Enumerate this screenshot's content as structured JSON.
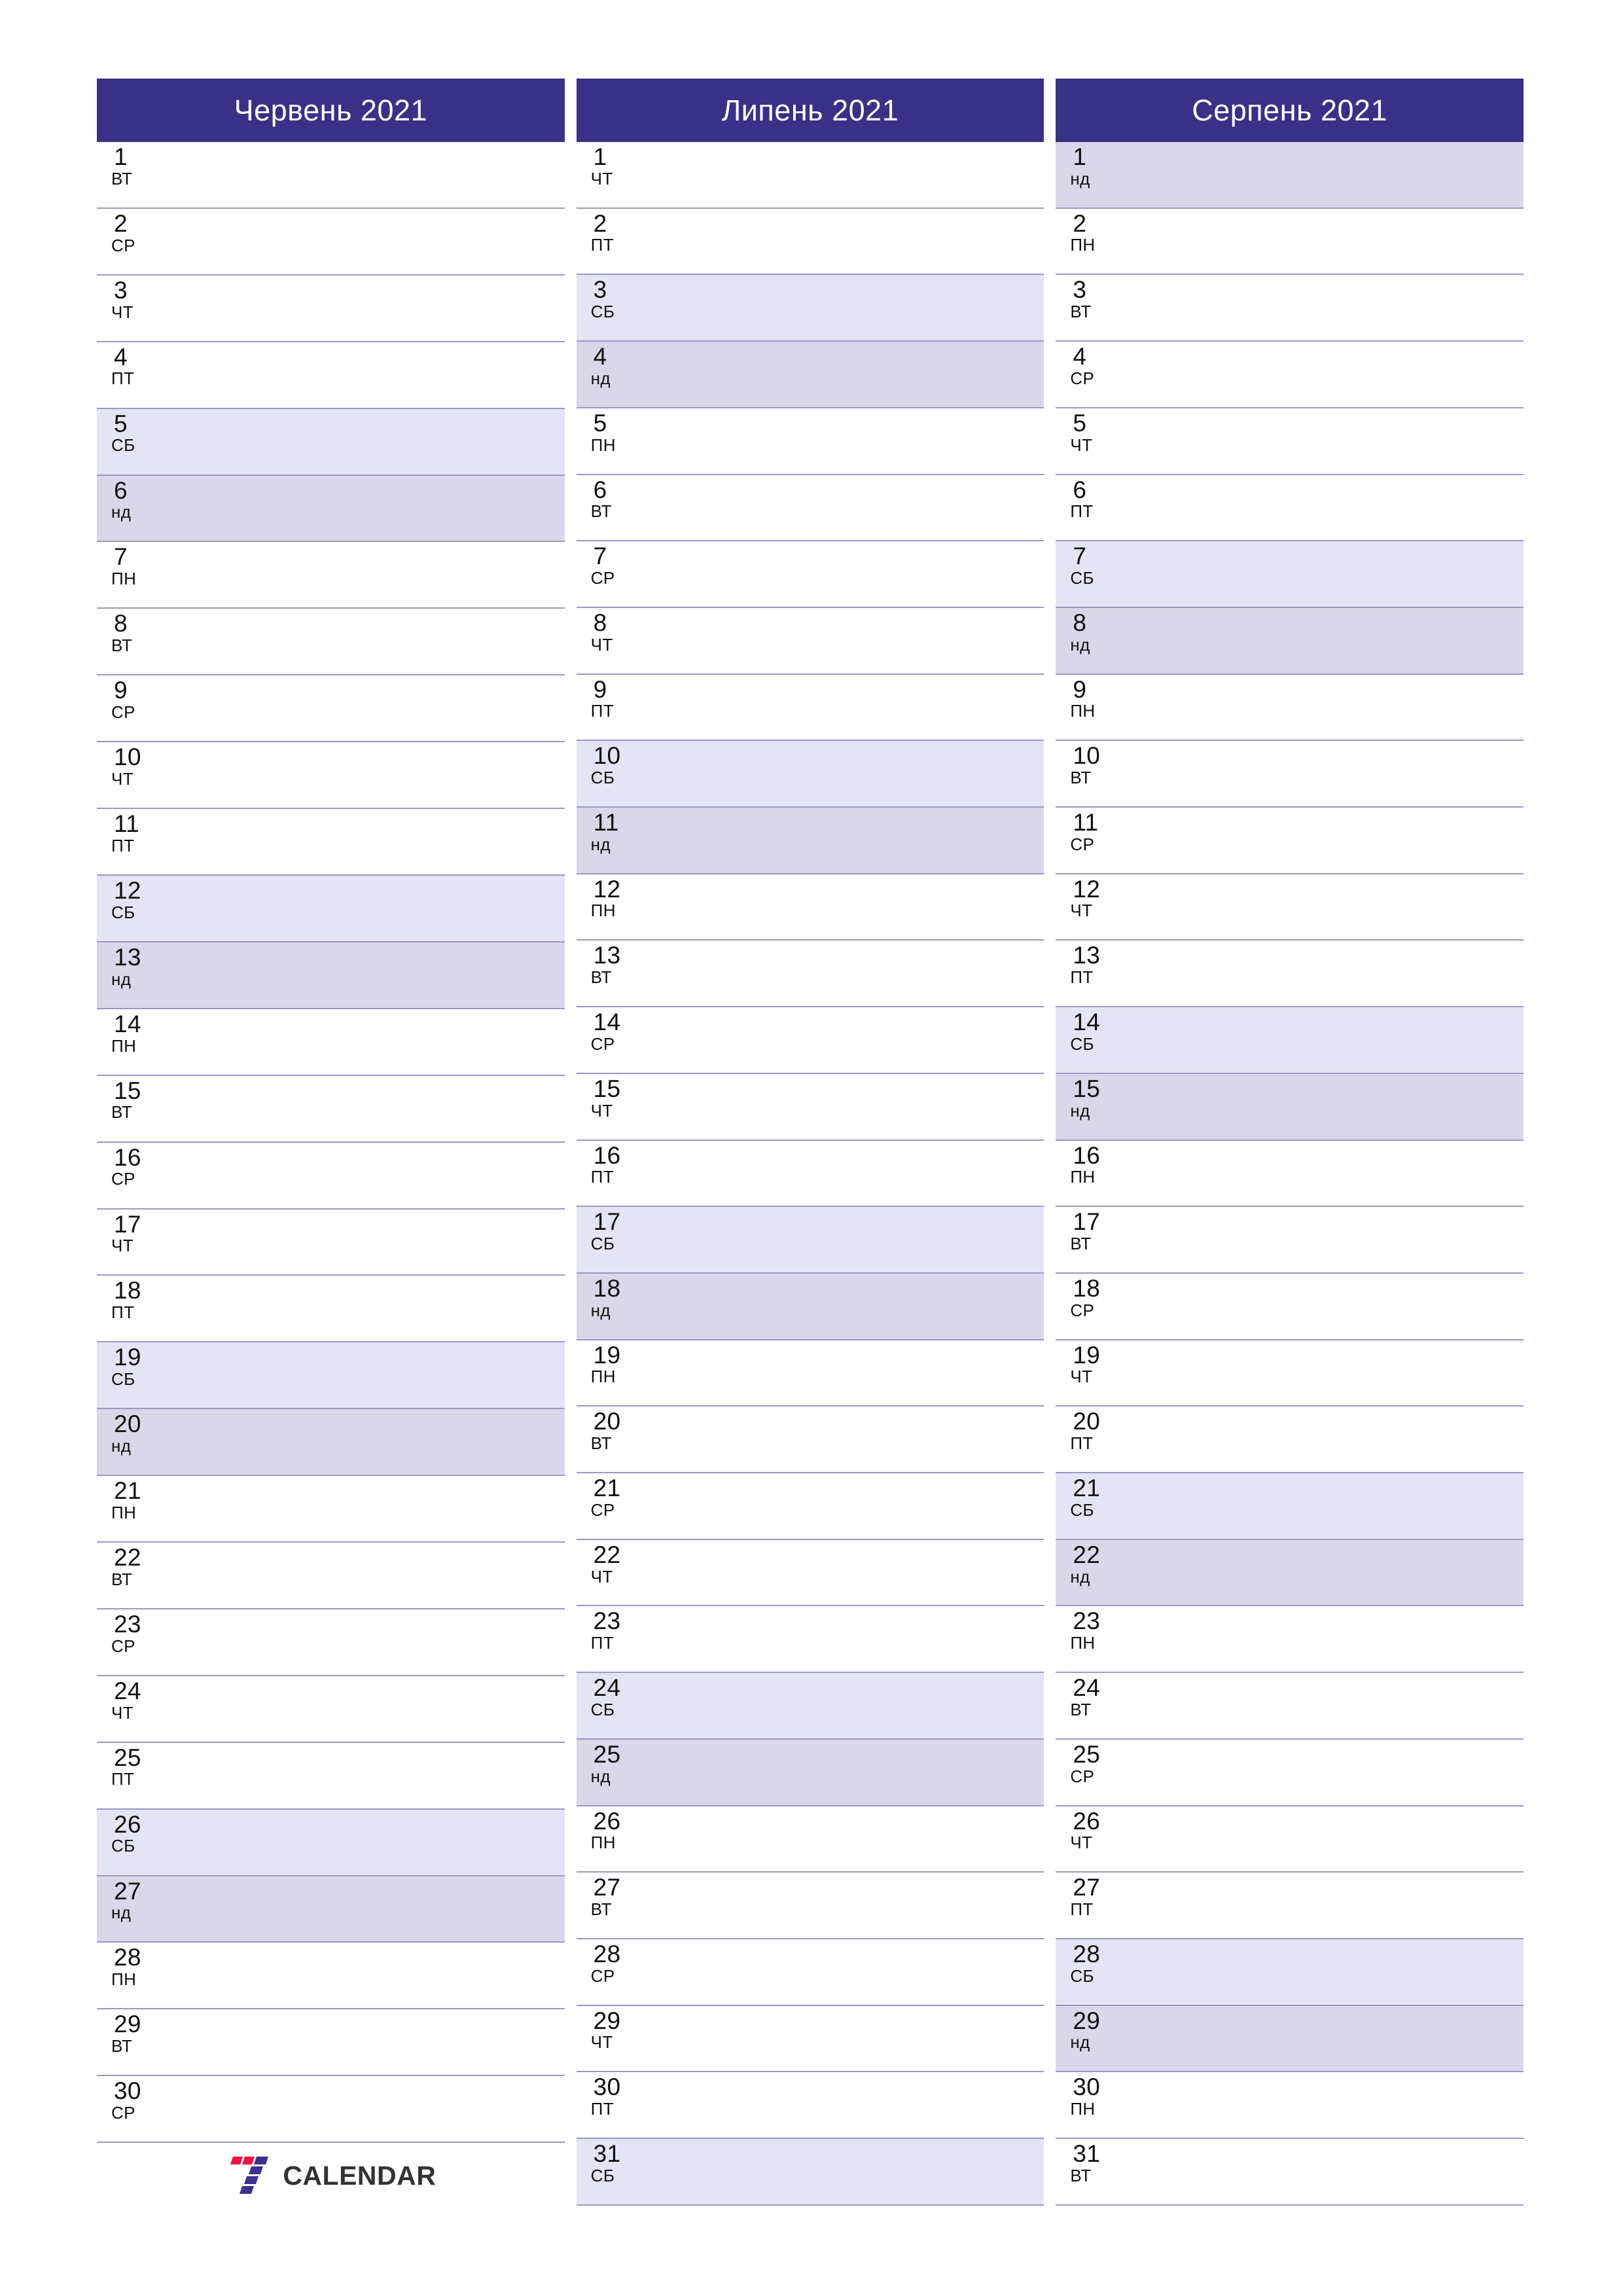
{
  "colors": {
    "header_bg": "#393087",
    "header_text": "#ffffff",
    "saturday_bg": "#e4e4f6",
    "sunday_bg": "#dbd7ea",
    "rule": "#9b97c4",
    "logo_red": "#f50f3f",
    "logo_blue": "#3b3190",
    "logo_text": "#333333"
  },
  "brand": {
    "name": "CALENDAR",
    "mark": "seven-logo-icon"
  },
  "months": [
    {
      "title": "Червень 2021",
      "days": [
        {
          "num": "1",
          "dow": "ВТ",
          "type": "weekday"
        },
        {
          "num": "2",
          "dow": "СР",
          "type": "weekday"
        },
        {
          "num": "3",
          "dow": "ЧТ",
          "type": "weekday"
        },
        {
          "num": "4",
          "dow": "ПТ",
          "type": "weekday"
        },
        {
          "num": "5",
          "dow": "СБ",
          "type": "sat"
        },
        {
          "num": "6",
          "dow": "нд",
          "type": "sun"
        },
        {
          "num": "7",
          "dow": "ПН",
          "type": "weekday"
        },
        {
          "num": "8",
          "dow": "ВТ",
          "type": "weekday"
        },
        {
          "num": "9",
          "dow": "СР",
          "type": "weekday"
        },
        {
          "num": "10",
          "dow": "ЧТ",
          "type": "weekday"
        },
        {
          "num": "11",
          "dow": "ПТ",
          "type": "weekday"
        },
        {
          "num": "12",
          "dow": "СБ",
          "type": "sat"
        },
        {
          "num": "13",
          "dow": "нд",
          "type": "sun"
        },
        {
          "num": "14",
          "dow": "ПН",
          "type": "weekday"
        },
        {
          "num": "15",
          "dow": "ВТ",
          "type": "weekday"
        },
        {
          "num": "16",
          "dow": "СР",
          "type": "weekday"
        },
        {
          "num": "17",
          "dow": "ЧТ",
          "type": "weekday"
        },
        {
          "num": "18",
          "dow": "ПТ",
          "type": "weekday"
        },
        {
          "num": "19",
          "dow": "СБ",
          "type": "sat"
        },
        {
          "num": "20",
          "dow": "нд",
          "type": "sun"
        },
        {
          "num": "21",
          "dow": "ПН",
          "type": "weekday"
        },
        {
          "num": "22",
          "dow": "ВТ",
          "type": "weekday"
        },
        {
          "num": "23",
          "dow": "СР",
          "type": "weekday"
        },
        {
          "num": "24",
          "dow": "ЧТ",
          "type": "weekday"
        },
        {
          "num": "25",
          "dow": "ПТ",
          "type": "weekday"
        },
        {
          "num": "26",
          "dow": "СБ",
          "type": "sat"
        },
        {
          "num": "27",
          "dow": "нд",
          "type": "sun"
        },
        {
          "num": "28",
          "dow": "ПН",
          "type": "weekday"
        },
        {
          "num": "29",
          "dow": "ВТ",
          "type": "weekday"
        },
        {
          "num": "30",
          "dow": "СР",
          "type": "weekday"
        }
      ],
      "trailing_slot": "logo"
    },
    {
      "title": "Липень 2021",
      "days": [
        {
          "num": "1",
          "dow": "ЧТ",
          "type": "weekday"
        },
        {
          "num": "2",
          "dow": "ПТ",
          "type": "weekday"
        },
        {
          "num": "3",
          "dow": "СБ",
          "type": "sat"
        },
        {
          "num": "4",
          "dow": "нд",
          "type": "sun"
        },
        {
          "num": "5",
          "dow": "ПН",
          "type": "weekday"
        },
        {
          "num": "6",
          "dow": "ВТ",
          "type": "weekday"
        },
        {
          "num": "7",
          "dow": "СР",
          "type": "weekday"
        },
        {
          "num": "8",
          "dow": "ЧТ",
          "type": "weekday"
        },
        {
          "num": "9",
          "dow": "ПТ",
          "type": "weekday"
        },
        {
          "num": "10",
          "dow": "СБ",
          "type": "sat"
        },
        {
          "num": "11",
          "dow": "нд",
          "type": "sun"
        },
        {
          "num": "12",
          "dow": "ПН",
          "type": "weekday"
        },
        {
          "num": "13",
          "dow": "ВТ",
          "type": "weekday"
        },
        {
          "num": "14",
          "dow": "СР",
          "type": "weekday"
        },
        {
          "num": "15",
          "dow": "ЧТ",
          "type": "weekday"
        },
        {
          "num": "16",
          "dow": "ПТ",
          "type": "weekday"
        },
        {
          "num": "17",
          "dow": "СБ",
          "type": "sat"
        },
        {
          "num": "18",
          "dow": "нд",
          "type": "sun"
        },
        {
          "num": "19",
          "dow": "ПН",
          "type": "weekday"
        },
        {
          "num": "20",
          "dow": "ВТ",
          "type": "weekday"
        },
        {
          "num": "21",
          "dow": "СР",
          "type": "weekday"
        },
        {
          "num": "22",
          "dow": "ЧТ",
          "type": "weekday"
        },
        {
          "num": "23",
          "dow": "ПТ",
          "type": "weekday"
        },
        {
          "num": "24",
          "dow": "СБ",
          "type": "sat"
        },
        {
          "num": "25",
          "dow": "нд",
          "type": "sun"
        },
        {
          "num": "26",
          "dow": "ПН",
          "type": "weekday"
        },
        {
          "num": "27",
          "dow": "ВТ",
          "type": "weekday"
        },
        {
          "num": "28",
          "dow": "СР",
          "type": "weekday"
        },
        {
          "num": "29",
          "dow": "ЧТ",
          "type": "weekday"
        },
        {
          "num": "30",
          "dow": "ПТ",
          "type": "weekday"
        },
        {
          "num": "31",
          "dow": "СБ",
          "type": "sat"
        }
      ],
      "trailing_slot": "none"
    },
    {
      "title": "Серпень 2021",
      "days": [
        {
          "num": "1",
          "dow": "нд",
          "type": "sun"
        },
        {
          "num": "2",
          "dow": "ПН",
          "type": "weekday"
        },
        {
          "num": "3",
          "dow": "ВТ",
          "type": "weekday"
        },
        {
          "num": "4",
          "dow": "СР",
          "type": "weekday"
        },
        {
          "num": "5",
          "dow": "ЧТ",
          "type": "weekday"
        },
        {
          "num": "6",
          "dow": "ПТ",
          "type": "weekday"
        },
        {
          "num": "7",
          "dow": "СБ",
          "type": "sat"
        },
        {
          "num": "8",
          "dow": "нд",
          "type": "sun"
        },
        {
          "num": "9",
          "dow": "ПН",
          "type": "weekday"
        },
        {
          "num": "10",
          "dow": "ВТ",
          "type": "weekday"
        },
        {
          "num": "11",
          "dow": "СР",
          "type": "weekday"
        },
        {
          "num": "12",
          "dow": "ЧТ",
          "type": "weekday"
        },
        {
          "num": "13",
          "dow": "ПТ",
          "type": "weekday"
        },
        {
          "num": "14",
          "dow": "СБ",
          "type": "sat"
        },
        {
          "num": "15",
          "dow": "нд",
          "type": "sun"
        },
        {
          "num": "16",
          "dow": "ПН",
          "type": "weekday"
        },
        {
          "num": "17",
          "dow": "ВТ",
          "type": "weekday"
        },
        {
          "num": "18",
          "dow": "СР",
          "type": "weekday"
        },
        {
          "num": "19",
          "dow": "ЧТ",
          "type": "weekday"
        },
        {
          "num": "20",
          "dow": "ПТ",
          "type": "weekday"
        },
        {
          "num": "21",
          "dow": "СБ",
          "type": "sat"
        },
        {
          "num": "22",
          "dow": "нд",
          "type": "sun"
        },
        {
          "num": "23",
          "dow": "ПН",
          "type": "weekday"
        },
        {
          "num": "24",
          "dow": "ВТ",
          "type": "weekday"
        },
        {
          "num": "25",
          "dow": "СР",
          "type": "weekday"
        },
        {
          "num": "26",
          "dow": "ЧТ",
          "type": "weekday"
        },
        {
          "num": "27",
          "dow": "ПТ",
          "type": "weekday"
        },
        {
          "num": "28",
          "dow": "СБ",
          "type": "sat"
        },
        {
          "num": "29",
          "dow": "нд",
          "type": "sun"
        },
        {
          "num": "30",
          "dow": "ПН",
          "type": "weekday"
        },
        {
          "num": "31",
          "dow": "ВТ",
          "type": "weekday"
        }
      ],
      "trailing_slot": "none"
    }
  ]
}
